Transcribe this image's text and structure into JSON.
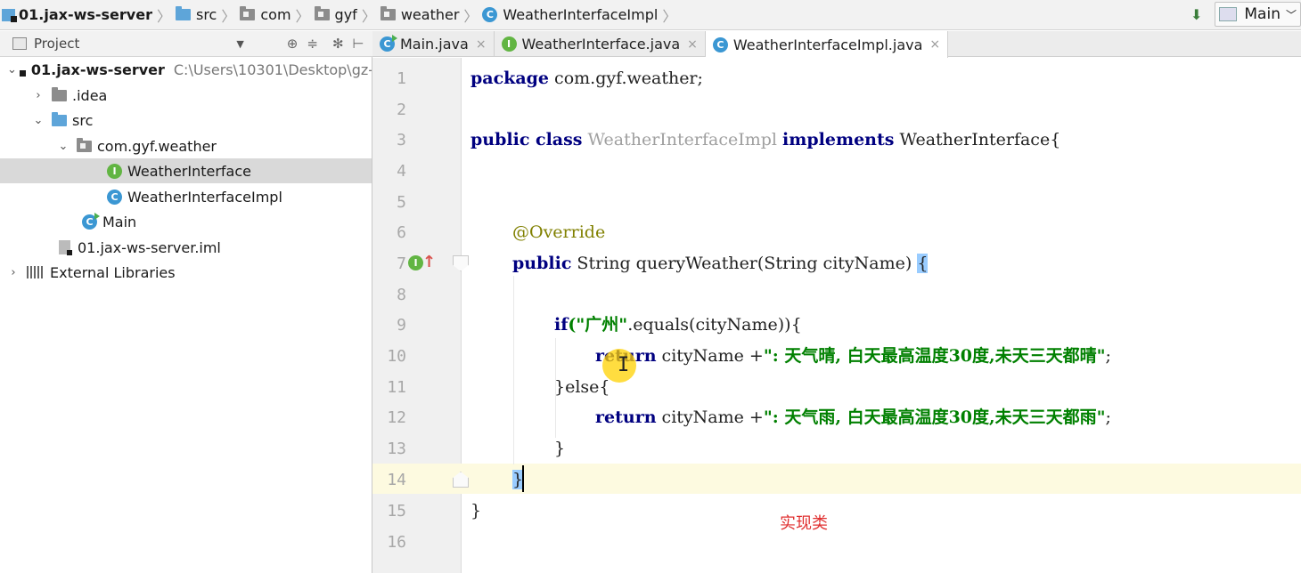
{
  "breadcrumb": {
    "items": [
      {
        "label": "01.jax-ws-server",
        "icon": "module-icon"
      },
      {
        "label": "src",
        "icon": "folder-icon"
      },
      {
        "label": "com",
        "icon": "package-icon"
      },
      {
        "label": "gyf",
        "icon": "package-icon"
      },
      {
        "label": "weather",
        "icon": "package-icon"
      },
      {
        "label": "WeatherInterfaceImpl",
        "icon": "class-icon"
      }
    ]
  },
  "run_config": {
    "label": "Main"
  },
  "project_panel": {
    "title": "Project",
    "tree": {
      "root_label": "01.jax-ws-server",
      "root_path": "C:\\Users\\10301\\Desktop\\gz-",
      "idea": ".idea",
      "src": "src",
      "package": "com.gyf.weather",
      "interface": "WeatherInterface",
      "impl": "WeatherInterfaceImpl",
      "main": "Main",
      "iml": "01.jax-ws-server.iml",
      "libs": "External Libraries"
    }
  },
  "tabs": [
    {
      "label": "Main.java",
      "icon": "class-icon"
    },
    {
      "label": "WeatherInterface.java",
      "icon": "interface-icon"
    },
    {
      "label": "WeatherInterfaceImpl.java",
      "icon": "class-icon",
      "active": true
    }
  ],
  "editor": {
    "line_numbers": [
      "1",
      "2",
      "3",
      "4",
      "5",
      "6",
      "7",
      "8",
      "9",
      "10",
      "11",
      "12",
      "13",
      "14",
      "15",
      "16"
    ],
    "code": {
      "l1_kw": "package",
      "l1_rest": " com.gyf.weather;",
      "l3_kw1": "public class",
      "l3_cls": " WeatherInterfaceImpl ",
      "l3_kw2": "implements",
      "l3_rest": " WeatherInterface{",
      "l6_anno": "@Override",
      "l7_kw": "public",
      "l7_rest": " String queryWeather(String cityName) ",
      "l7_brace": "{",
      "l9_kw": "if",
      "l9_str": "(\"广州\"",
      "l9_rest": ".equals(cityName)){",
      "l10_kw": "return",
      "l10_rest": " cityName +",
      "l10_str": "\": 天气晴, 白天最高温度30度,未天三天都晴\"",
      "l10_end": ";",
      "l11": "}else{",
      "l12_kw": "return",
      "l12_rest": " cityName +",
      "l12_str": "\": 天气雨, 白天最高温度30度,未天三天都雨\"",
      "l12_end": ";",
      "l13": "}",
      "l14": "}",
      "l15": "}"
    },
    "annotation": "实现类"
  }
}
